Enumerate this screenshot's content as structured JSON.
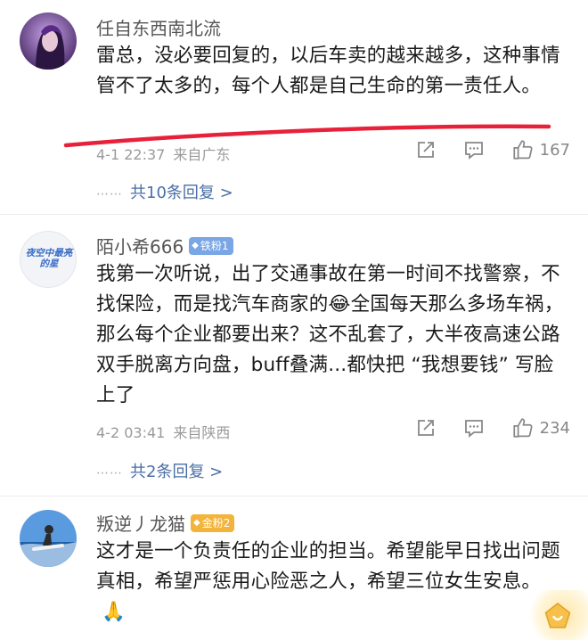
{
  "comments": [
    {
      "username": "任自东西南北流",
      "text": "雷总，没必要回复的，以后车卖的越来越多，这种事情管不了太多的，每个人都是自己生命的第一责任人。",
      "time": "4-1 22:37",
      "location": "来自广东",
      "likes": "167",
      "replies_label": "共10条回复 >"
    },
    {
      "username": "陌小希666",
      "badge": "铁粉1",
      "text_before": "我第一次听说，出了交通事故在第一时间不找警察，不找保险，而是找汽车商家的",
      "emoji": "😂",
      "text_after": "全国每天那么多场车祸，那么每个企业都要出来？这不乱套了，大半夜高速公路双手脱离方向盘，buff叠满...都快把 “我想要钱” 写脸上了",
      "avatar_text": "夜空中最亮的星",
      "time": "4-2 03:41",
      "location": "来自陕西",
      "likes": "234",
      "replies_label": "共2条回复 >"
    },
    {
      "username": "叛逆丿龙猫",
      "badge": "金粉2",
      "text": "这才是一个负责任的企业的担当。希望能早日找出问题真相，希望严惩用心险恶之人，希望三位女生安息。",
      "emoji": "🙏"
    }
  ],
  "icons": {
    "share": "share-icon",
    "comment": "comment-icon",
    "like": "thumbs-up-icon"
  },
  "colors": {
    "reply_link": "#4a6fa5",
    "annotation": "#e8213a",
    "iron_badge": "#7aa6e6",
    "gold_badge": "#f3b43b"
  }
}
